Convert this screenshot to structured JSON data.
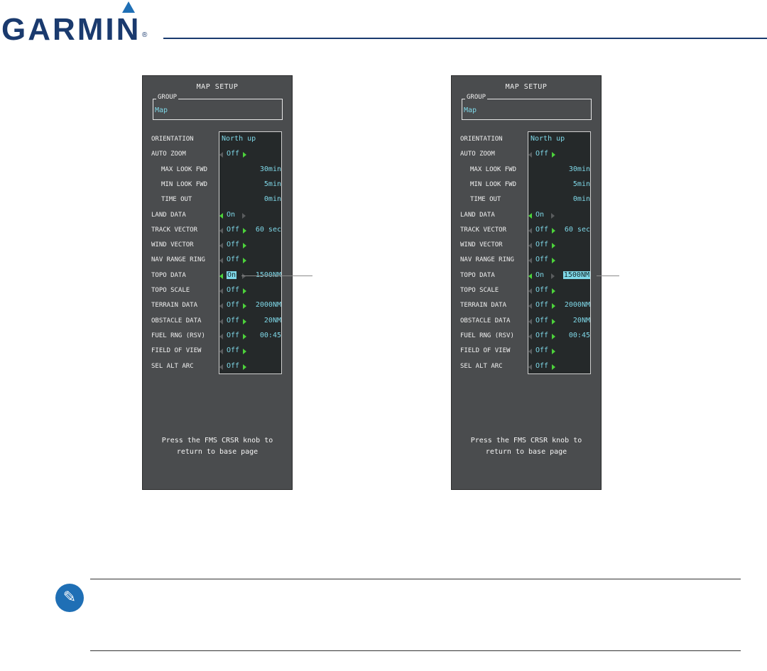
{
  "header": {
    "brand": "GARMIN",
    "reg_mark": "."
  },
  "panels": [
    {
      "title": "MAP SETUP",
      "group_label": "GROUP",
      "group_value": "Map",
      "rows": [
        {
          "label": "ORIENTATION",
          "left": "North up"
        },
        {
          "label": "AUTO ZOOM",
          "left": "Off"
        },
        {
          "label": "MAX LOOK FWD",
          "right": "30min"
        },
        {
          "label": "MIN LOOK FWD",
          "right": "5min"
        },
        {
          "label": "TIME OUT",
          "right": "0min"
        },
        {
          "label": "LAND DATA",
          "left": "On"
        },
        {
          "label": "TRACK VECTOR",
          "left": "Off",
          "right": "60 sec"
        },
        {
          "label": "WIND VECTOR",
          "left": "Off"
        },
        {
          "label": "NAV RANGE RING",
          "left": "Off"
        },
        {
          "label": "TOPO DATA",
          "left": "On",
          "right": "1500NM"
        },
        {
          "label": "TOPO SCALE",
          "left": "Off"
        },
        {
          "label": "TERRAIN DATA",
          "left": "Off",
          "right": "2000NM"
        },
        {
          "label": "OBSTACLE DATA",
          "left": "Off",
          "right": "20NM"
        },
        {
          "label": "FUEL RNG (RSV)",
          "left": "Off",
          "right": "00:45"
        },
        {
          "label": "FIELD OF VIEW",
          "left": "Off"
        },
        {
          "label": "SEL ALT ARC",
          "left": "Off"
        }
      ],
      "footer_line1": "Press the FMS CRSR knob to",
      "footer_line2": "return to base page"
    },
    {
      "title": "MAP SETUP",
      "group_label": "GROUP",
      "group_value": "Map",
      "rows": [
        {
          "label": "ORIENTATION",
          "left": "North up"
        },
        {
          "label": "AUTO ZOOM",
          "left": "Off"
        },
        {
          "label": "MAX LOOK FWD",
          "right": "30min"
        },
        {
          "label": "MIN LOOK FWD",
          "right": "5min"
        },
        {
          "label": "TIME OUT",
          "right": "0min"
        },
        {
          "label": "LAND DATA",
          "left": "On"
        },
        {
          "label": "TRACK VECTOR",
          "left": "Off",
          "right": "60 sec"
        },
        {
          "label": "WIND VECTOR",
          "left": "Off"
        },
        {
          "label": "NAV RANGE RING",
          "left": "Off"
        },
        {
          "label": "TOPO DATA",
          "left": "On",
          "right": "1500NM"
        },
        {
          "label": "TOPO SCALE",
          "left": "Off"
        },
        {
          "label": "TERRAIN DATA",
          "left": "Off",
          "right": "2000NM"
        },
        {
          "label": "OBSTACLE DATA",
          "left": "Off",
          "right": "20NM"
        },
        {
          "label": "FUEL RNG (RSV)",
          "left": "Off",
          "right": "00:45"
        },
        {
          "label": "FIELD OF VIEW",
          "left": "Off"
        },
        {
          "label": "SEL ALT ARC",
          "left": "Off"
        }
      ],
      "footer_line1": "Press the FMS CRSR knob to",
      "footer_line2": "return to base page"
    }
  ],
  "colors": {
    "brand": "#1a3a6e",
    "value": "#7fd8e8",
    "arrow": "#4cd13b",
    "panel": "#4a4c4e"
  },
  "icons": {
    "note": "pencil-check-icon"
  }
}
